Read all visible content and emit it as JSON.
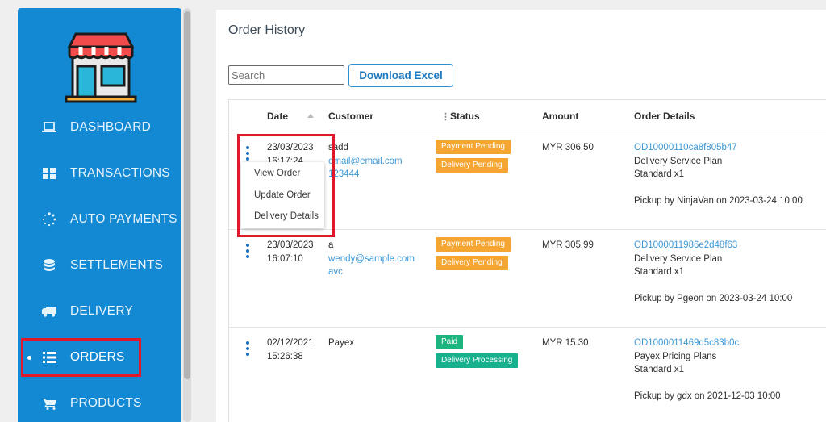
{
  "sidebar": {
    "items": [
      {
        "label": "DASHBOARD",
        "icon": "laptop-icon"
      },
      {
        "label": "TRANSACTIONS",
        "icon": "grid-icon"
      },
      {
        "label": "AUTO PAYMENTS",
        "icon": "loading-dots-icon"
      },
      {
        "label": "SETTLEMENTS",
        "icon": "database-icon"
      },
      {
        "label": "DELIVERY",
        "icon": "truck-icon"
      },
      {
        "label": "ORDERS",
        "icon": "list-icon",
        "active": true
      },
      {
        "label": "PRODUCTS",
        "icon": "cart-icon"
      }
    ]
  },
  "main": {
    "title": "Order History",
    "search": {
      "placeholder": "Search",
      "value": ""
    },
    "download_label": "Download Excel",
    "columns": [
      "Date",
      "Customer",
      "Status",
      "Amount",
      "Order Details"
    ],
    "orders": [
      {
        "date": "23/03/2023",
        "time": "16:17:24",
        "customer_name": "sadd",
        "customer_email": "email@email.com",
        "customer_phone": "123444",
        "status1": "Payment Pending",
        "status2": "Delivery Pending",
        "amount": "MYR 306.50",
        "order_id": "OD10000110ca8f805b47",
        "plan": "Delivery Service Plan",
        "qty": "Standard x1",
        "pickup": "Pickup by NinjaVan on 2023-03-24 10:00"
      },
      {
        "date": "23/03/2023",
        "time": "16:07:10",
        "customer_name": "a",
        "customer_email": "wendy@sample.com",
        "customer_phone": "avc",
        "status1": "Payment Pending",
        "status2": "Delivery Pending",
        "amount": "MYR 305.99",
        "order_id": "OD1000011986e2d48f63",
        "plan": "Delivery Service Plan",
        "qty": "Standard x1",
        "pickup": "Pickup by Pgeon on 2023-03-24 10:00"
      },
      {
        "date": "02/12/2021",
        "time": "15:26:38",
        "customer_name": "Payex",
        "customer_email": "",
        "customer_phone": "",
        "status1": "Paid",
        "status2": "Delivery Processing",
        "amount": "MYR 15.30",
        "order_id": "OD1000011469d5c83b0c",
        "plan": "Payex Pricing Plans",
        "qty": "Standard x1",
        "pickup": "Pickup by gdx on 2021-12-03 10:00"
      }
    ],
    "context_menu": [
      "View Order",
      "Update Order",
      "Delivery Details"
    ]
  },
  "colors": {
    "sidebar": "#1388d3",
    "highlight": "#e0182a",
    "pending": "#f5a532",
    "paid": "#1cb57f",
    "link": "#3d98d6"
  }
}
